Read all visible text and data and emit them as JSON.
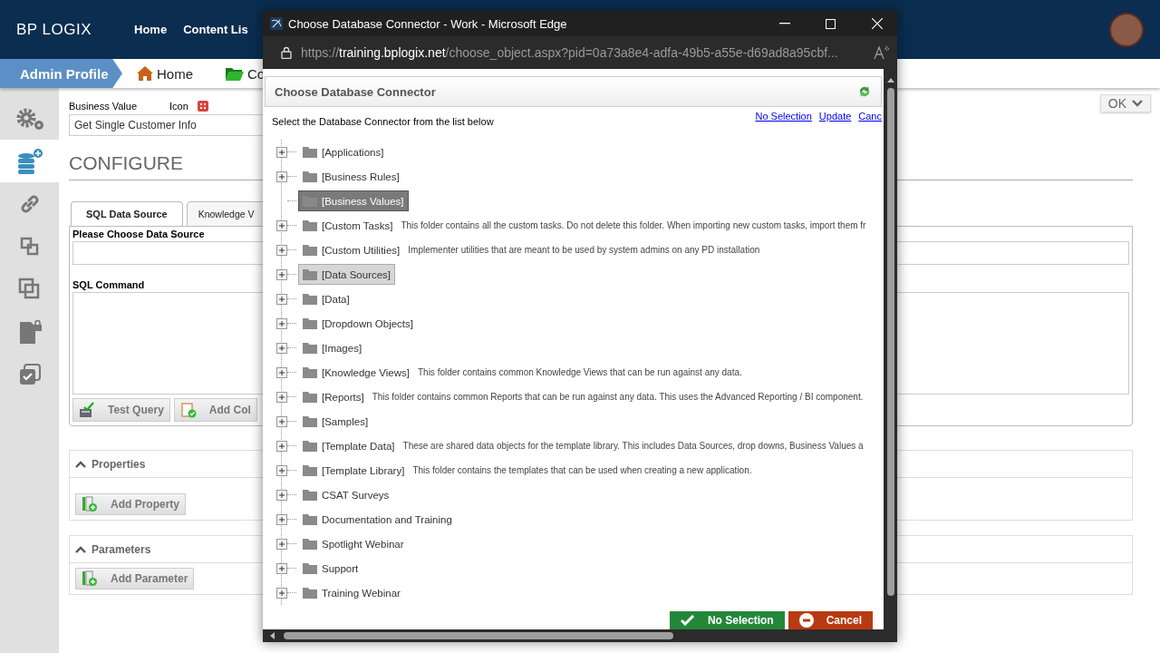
{
  "header": {
    "logo": "BP LOGIX",
    "nav": [
      "Home",
      "Content Lis"
    ]
  },
  "breadcrumb": {
    "profile": "Admin Profile",
    "items": [
      {
        "label": "Home",
        "kind": "home"
      },
      {
        "label": "Co",
        "kind": "folder"
      }
    ]
  },
  "sidebar": {
    "items": [
      {
        "kind": "gears",
        "selected": false
      },
      {
        "kind": "database",
        "selected": true
      },
      {
        "kind": "link",
        "selected": false
      },
      {
        "kind": "squares",
        "selected": false
      },
      {
        "kind": "overlap",
        "selected": false
      },
      {
        "kind": "file-lock",
        "selected": false
      },
      {
        "kind": "check",
        "selected": false
      }
    ]
  },
  "form": {
    "business_value_label": "Business Value",
    "icon_label": "Icon",
    "business_value": "Get Single Customer Info",
    "heading": "CONFIGURE",
    "ok_button": "OK"
  },
  "tabs": [
    {
      "label": "SQL Data Source",
      "selected": true
    },
    {
      "label": "Knowledge V",
      "selected": false
    }
  ],
  "sql": {
    "data_source_label": "Please Choose Data Source",
    "command_label": "SQL Command",
    "buttons": [
      {
        "label": "Test Query",
        "kind": "test"
      },
      {
        "label": "Add Col",
        "kind": "add-column"
      }
    ]
  },
  "sections": [
    {
      "title": "Properties",
      "expanded": true,
      "button": "Add Property"
    },
    {
      "title": "Parameters",
      "expanded": true,
      "button": "Add Parameter"
    }
  ],
  "popup": {
    "title": "Choose Database Connector - Work - Microsoft Edge",
    "url_scheme": "https://",
    "url_host": "training.bplogix.net",
    "url_path": "/choose_object.aspx?pid=0a73a8e4-adfa-49b5-a55e-d69ad8a95cbf...",
    "heading": "Choose Database Connector",
    "instruction": "Select the Database Connector from the list below",
    "links": [
      "No Selection",
      "Update",
      "Canc"
    ],
    "tree": [
      {
        "label": "[Applications]",
        "expandable": true,
        "selected": false,
        "hovered": false
      },
      {
        "label": "[Business Rules]",
        "expandable": true,
        "selected": false,
        "hovered": false
      },
      {
        "label": "[Business Values]",
        "expandable": false,
        "selected": true,
        "hovered": false
      },
      {
        "label": "[Custom Tasks]",
        "description": "This folder contains all the custom tasks. Do not delete this folder. When importing new custom tasks, import them fr",
        "expandable": true,
        "selected": false,
        "hovered": false
      },
      {
        "label": "[Custom Utilities]",
        "description": "Implementer utilities that are meant to be used by system admins on any PD installation",
        "expandable": true,
        "selected": false,
        "hovered": false
      },
      {
        "label": "[Data Sources]",
        "expandable": true,
        "selected": false,
        "hovered": true
      },
      {
        "label": "[Data]",
        "expandable": true,
        "selected": false,
        "hovered": false
      },
      {
        "label": "[Dropdown Objects]",
        "expandable": true,
        "selected": false,
        "hovered": false
      },
      {
        "label": "[Images]",
        "expandable": true,
        "selected": false,
        "hovered": false
      },
      {
        "label": "[Knowledge Views]",
        "description": "This folder contains common Knowledge Views that can be run against any data.",
        "expandable": true,
        "selected": false,
        "hovered": false
      },
      {
        "label": "[Reports]",
        "description": "This folder contains common Reports that can be run against any data. This uses the Advanced Reporting / BI component.",
        "expandable": true,
        "selected": false,
        "hovered": false
      },
      {
        "label": "[Samples]",
        "expandable": true,
        "selected": false,
        "hovered": false
      },
      {
        "label": "[Template Data]",
        "description": "These are shared data objects for the template library. This includes Data Sources, drop downs, Business Values a",
        "expandable": true,
        "selected": false,
        "hovered": false
      },
      {
        "label": "[Template Library]",
        "description": "This folder contains the templates that can be used when creating a new application.",
        "expandable": true,
        "selected": false,
        "hovered": false
      },
      {
        "label": "CSAT Surveys",
        "expandable": true,
        "selected": false,
        "hovered": false
      },
      {
        "label": "Documentation and Training",
        "expandable": true,
        "selected": false,
        "hovered": false
      },
      {
        "label": "Spotlight Webinar",
        "expandable": true,
        "selected": false,
        "hovered": false
      },
      {
        "label": "Support",
        "expandable": true,
        "selected": false,
        "hovered": false
      },
      {
        "label": "Training Webinar",
        "expandable": true,
        "selected": false,
        "hovered": false
      }
    ],
    "buttons": [
      {
        "label": "No Selection",
        "kind": "confirm"
      },
      {
        "label": "Cancel",
        "kind": "cancel"
      }
    ]
  }
}
